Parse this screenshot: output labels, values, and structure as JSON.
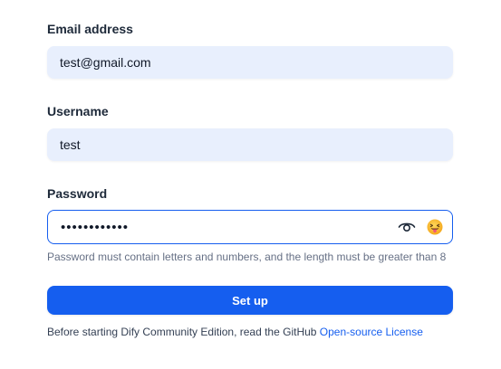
{
  "form": {
    "email": {
      "label": "Email address",
      "value": "test@gmail.com"
    },
    "username": {
      "label": "Username",
      "value": "test"
    },
    "password": {
      "label": "Password",
      "value": "••••••••••••",
      "toggle_icon": "eye-icon",
      "emoji_icon": "tongue-out-emoji-icon",
      "hint": "Password must contain letters and numbers, and the length must be greater than 8"
    },
    "submit_label": "Set up",
    "footer": {
      "text": "Before starting Dify Community Edition, read the GitHub ",
      "link_label": "Open-source License"
    }
  },
  "colors": {
    "accent": "#155eef",
    "input_bg": "#e8effd",
    "hint_text": "#667085"
  }
}
